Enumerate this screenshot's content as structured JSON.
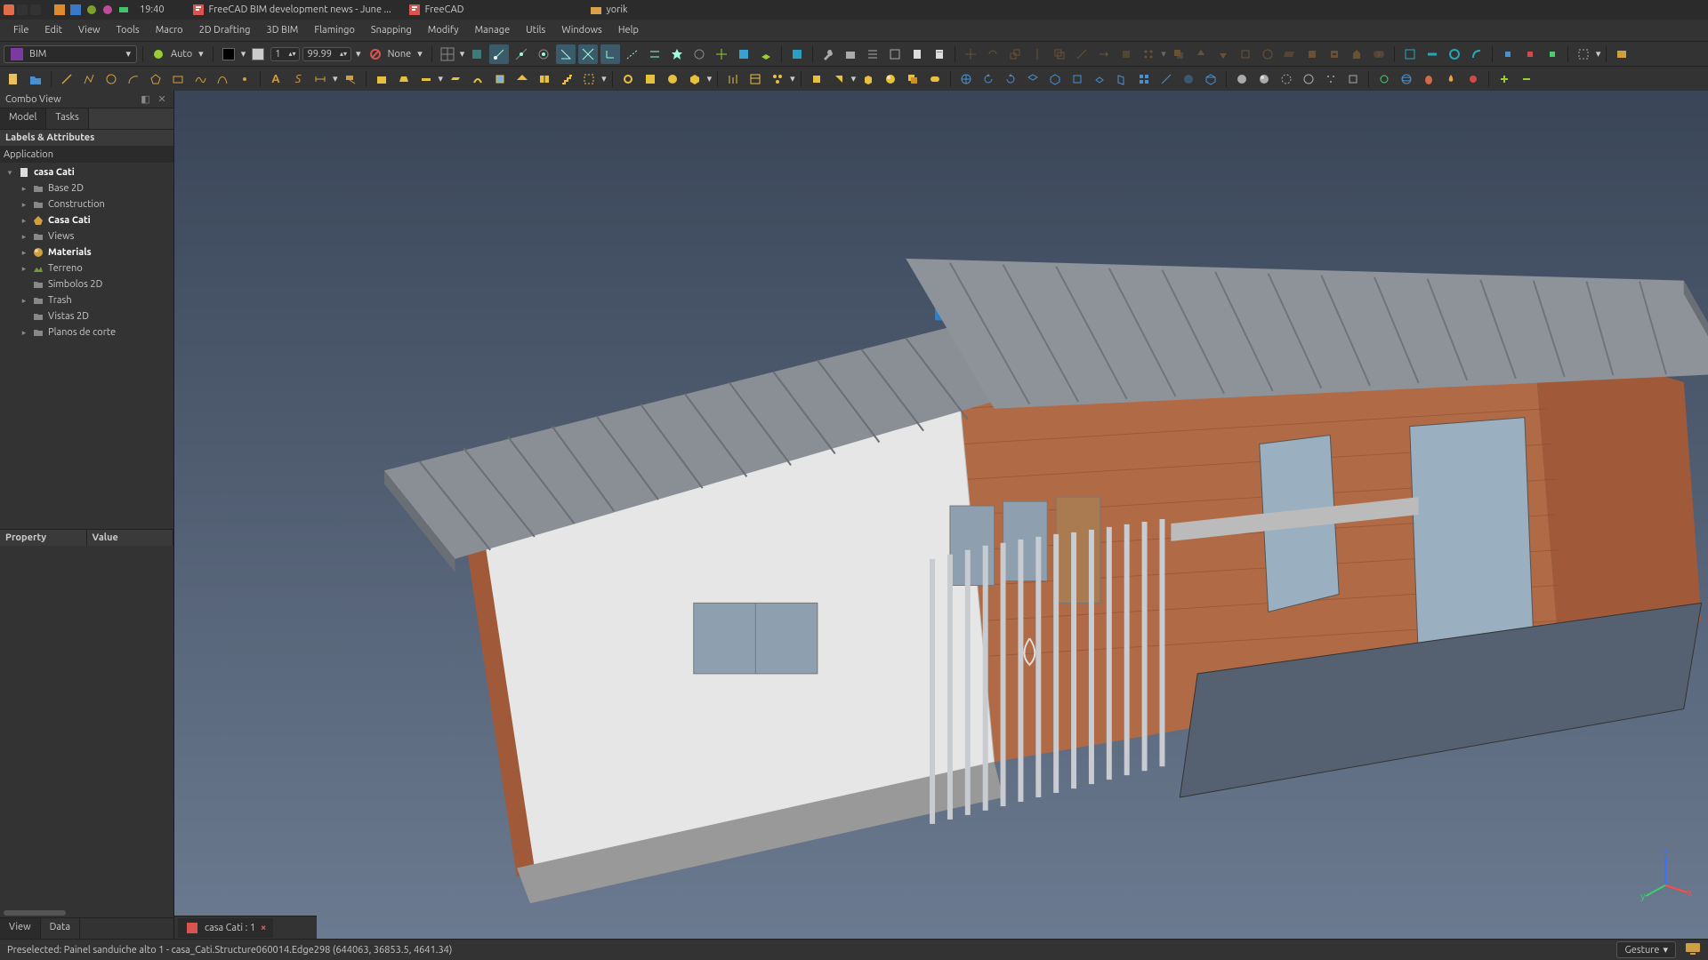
{
  "titlebar": {
    "time": "19:40",
    "tasks": [
      {
        "icon": "freecad",
        "label": "FreeCAD BIM development news - June ..."
      },
      {
        "icon": "freecad",
        "label": "FreeCAD"
      },
      {
        "icon": "folder",
        "label": "yorik"
      }
    ]
  },
  "menubar": [
    "File",
    "Edit",
    "View",
    "Tools",
    "Macro",
    "2D Drafting",
    "3D BIM",
    "Flamingo",
    "Snapping",
    "Modify",
    "Manage",
    "Utils",
    "Windows",
    "Help"
  ],
  "workbench": {
    "selected": "BIM"
  },
  "toolbar2": {
    "auto_label": "Auto",
    "spin_value": "99.99",
    "none_label": "None"
  },
  "combo": {
    "title": "Combo View",
    "tabs": [
      "Model",
      "Tasks"
    ],
    "section": "Labels & Attributes",
    "root": "Application",
    "tree": [
      {
        "indent": 0,
        "arrow": "▾",
        "icon": "doc",
        "label": "casa Cati",
        "bold": true
      },
      {
        "indent": 1,
        "arrow": "▸",
        "icon": "folder",
        "label": "Base 2D"
      },
      {
        "indent": 1,
        "arrow": "▸",
        "icon": "folder",
        "label": "Construction"
      },
      {
        "indent": 1,
        "arrow": "▸",
        "icon": "site",
        "label": "Casa Cati",
        "bold": true
      },
      {
        "indent": 1,
        "arrow": "▸",
        "icon": "folder",
        "label": "Views"
      },
      {
        "indent": 1,
        "arrow": "▸",
        "icon": "mat",
        "label": "Materials",
        "bold": true
      },
      {
        "indent": 1,
        "arrow": "▸",
        "icon": "terrain",
        "label": "Terreno"
      },
      {
        "indent": 1,
        "arrow": "",
        "icon": "folder",
        "label": "Simbolos 2D"
      },
      {
        "indent": 1,
        "arrow": "▸",
        "icon": "folder",
        "label": "Trash"
      },
      {
        "indent": 1,
        "arrow": "",
        "icon": "folder",
        "label": "Vistas 2D"
      },
      {
        "indent": 1,
        "arrow": "▸",
        "icon": "folder",
        "label": "Planos de corte"
      }
    ],
    "prop_hdr": [
      "Property",
      "Value"
    ],
    "bottom_tabs": [
      "View",
      "Data"
    ]
  },
  "doc_tab": {
    "label": "casa Cati : 1"
  },
  "statusbar": {
    "msg": "Preselected: Painel sanduiche alto 1 - casa_Cati.Structure060014.Edge298 (644063, 36853.5, 4641.34)",
    "nav": "Gesture"
  }
}
